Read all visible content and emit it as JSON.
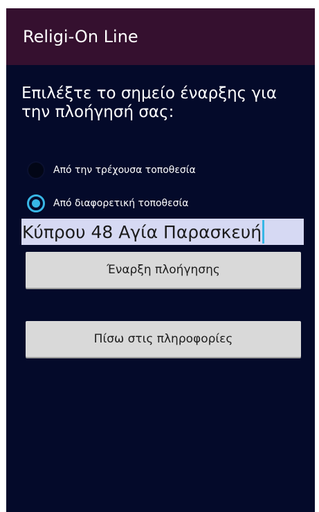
{
  "app": {
    "title": "Religi-On Line"
  },
  "prompt": {
    "text": "Επιλέξτε το σημείο έναρξης για την πλοήγησή σας:"
  },
  "options": {
    "current_location": "Από την τρέχουσα τοποθεσία",
    "other_location": "Από διαφορετική τοποθεσία",
    "selected": "other_location"
  },
  "address": {
    "value": "Κύπρου 48 Αγία Παρασκευή"
  },
  "buttons": {
    "start_navigation": "Έναρξη πλοήγησης",
    "back_to_info": "Πίσω στις πληροφορίες"
  },
  "colors": {
    "action_bar": "#35102f",
    "background": "#040a2a",
    "accent": "#38b7e6",
    "input_bg": "#d6d9f3",
    "button_bg": "#d9d9d9"
  }
}
